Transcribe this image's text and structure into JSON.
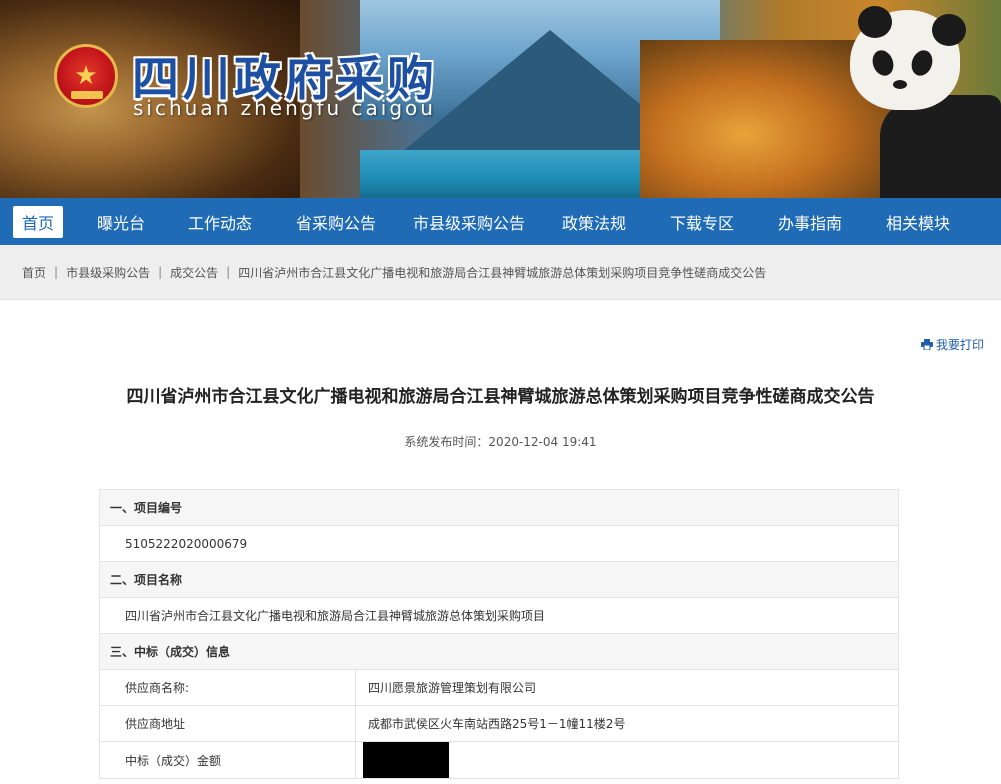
{
  "header": {
    "site_title": "四川政府采购",
    "site_pinyin": "sichuan zhengfu caigou"
  },
  "nav": {
    "items": [
      {
        "label": "首页",
        "active": true
      },
      {
        "label": "曝光台"
      },
      {
        "label": "工作动态"
      },
      {
        "label": "省采购公告"
      },
      {
        "label": "市县级采购公告"
      },
      {
        "label": "政策法规"
      },
      {
        "label": "下载专区"
      },
      {
        "label": "办事指南"
      },
      {
        "label": "相关模块"
      }
    ]
  },
  "breadcrumb": {
    "items": [
      "首页",
      "市县级采购公告",
      "成交公告",
      "四川省泸州市合江县文化广播电视和旅游局合江县神臂城旅游总体策划采购项目竞争性磋商成交公告"
    ]
  },
  "article": {
    "print_label": "我要打印",
    "title": "四川省泸州市合江县文化广播电视和旅游局合江县神臂城旅游总体策划采购项目竞争性磋商成交公告",
    "publish_time": "系统发布时间：2020-12-04 19:41"
  },
  "table": {
    "sections": {
      "s1_title": "一、项目编号",
      "s1_value": "5105222020000679",
      "s2_title": "二、项目名称",
      "s2_value": "四川省泸州市合江县文化广播电视和旅游局合江县神臂城旅游总体策划采购项目",
      "s3_title": "三、中标（成交）信息"
    },
    "rows": [
      {
        "label": "供应商名称:",
        "value": "四川愿景旅游管理策划有限公司"
      },
      {
        "label": "供应商地址",
        "value": "成都市武侯区火车南站西路25号1－1幢11楼2号"
      },
      {
        "label": "中标（成交）金额",
        "value": ""
      }
    ]
  },
  "colors": {
    "nav_bg": "#1f6bb6",
    "title_blue": "#1d4fa3",
    "link_blue": "#1f5ea8"
  },
  "icons": {
    "emblem": "national-emblem-icon",
    "print": "printer-icon"
  }
}
